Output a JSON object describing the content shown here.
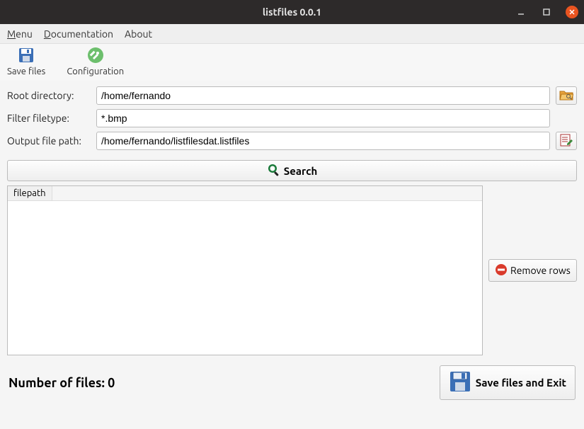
{
  "window": {
    "title": "listfiles 0.0.1"
  },
  "menubar": {
    "menu": "Menu",
    "documentation": "Documentation",
    "about": "About"
  },
  "toolbar": {
    "save_files": "Save files",
    "configuration": "Configuration"
  },
  "form": {
    "root_label": "Root directory:",
    "root_value": "/home/fernando",
    "filter_label": "Filter filetype:",
    "filter_value": "*.bmp",
    "output_label": "Output file path:",
    "output_value": "/home/fernando/listfilesdat.listfiles"
  },
  "search_button": "Search",
  "table": {
    "columns": [
      "filepath"
    ],
    "rows": []
  },
  "remove_rows": "Remove rows",
  "footer": {
    "count_label": "Number of files: 0",
    "save_exit": "Save files and Exit"
  }
}
